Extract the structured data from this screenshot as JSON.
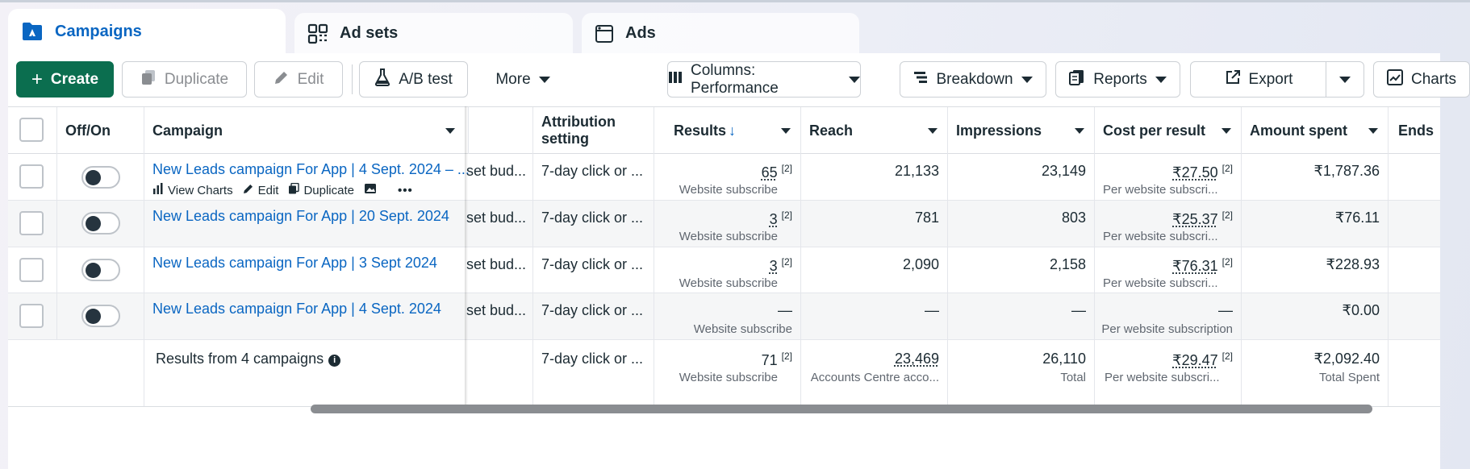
{
  "tabs": [
    {
      "label": "Campaigns",
      "icon": "campaign-folder-icon",
      "active": true
    },
    {
      "label": "Ad sets",
      "icon": "ad-sets-grid-icon",
      "active": false
    },
    {
      "label": "Ads",
      "icon": "ads-window-icon",
      "active": false
    }
  ],
  "toolbar": {
    "create": "Create",
    "duplicate": "Duplicate",
    "edit": "Edit",
    "ab_test": "A/B test",
    "more": "More",
    "columns": "Columns: Performance",
    "breakdown": "Breakdown",
    "reports": "Reports",
    "export": "Export",
    "charts": "Charts"
  },
  "columns": {
    "off_on": "Off/On",
    "campaign": "Campaign",
    "attribution_line1": "Attribution",
    "attribution_line2": "setting",
    "results": "Results",
    "results_sort": "↓",
    "reach": "Reach",
    "impressions": "Impressions",
    "cost_per_result": "Cost per result",
    "amount_spent": "Amount spent",
    "ends": "Ends"
  },
  "row_actions": {
    "view_charts": "View Charts",
    "edit": "Edit",
    "duplicate": "Duplicate",
    "more": "•••"
  },
  "rows": [
    {
      "name": "New Leads campaign For App | 4 Sept. 2024 – ...",
      "budget": "set bud...",
      "attribution": "7-day click or ...",
      "results": "65",
      "results_ref": "[2]",
      "results_sub": "Website subscribe",
      "reach": "21,133",
      "impressions": "23,149",
      "cpr": "₹27.50",
      "cpr_ref": "[2]",
      "cpr_sub": "Per website subscri...",
      "spent": "₹1,787.36"
    },
    {
      "name": "New Leads campaign For App | 20 Sept. 2024",
      "budget": "set bud...",
      "attribution": "7-day click or ...",
      "results": "3",
      "results_ref": "[2]",
      "results_sub": "Website subscribe",
      "reach": "781",
      "impressions": "803",
      "cpr": "₹25.37",
      "cpr_ref": "[2]",
      "cpr_sub": "Per website subscri...",
      "spent": "₹76.11"
    },
    {
      "name": "New Leads campaign For App | 3 Sept 2024",
      "budget": "set bud...",
      "attribution": "7-day click or ...",
      "results": "3",
      "results_ref": "[2]",
      "results_sub": "Website subscribe",
      "reach": "2,090",
      "impressions": "2,158",
      "cpr": "₹76.31",
      "cpr_ref": "[2]",
      "cpr_sub": "Per website subscri...",
      "spent": "₹228.93"
    },
    {
      "name": "New Leads campaign For App | 4 Sept. 2024",
      "budget": "set bud...",
      "attribution": "7-day click or ...",
      "results": "—",
      "results_ref": "",
      "results_sub": "Website subscribe",
      "reach": "—",
      "impressions": "—",
      "cpr": "—",
      "cpr_ref": "",
      "cpr_sub": "Per website subscription",
      "spent": "₹0.00"
    }
  ],
  "summary": {
    "label": "Results from 4 campaigns",
    "info_icon": "i",
    "attribution": "7-day click or ...",
    "results": "71",
    "results_ref": "[2]",
    "results_sub": "Website subscribe",
    "reach": "23,469",
    "reach_sub": "Accounts Centre acco...",
    "impressions": "26,110",
    "impressions_sub": "Total",
    "cpr": "₹29.47",
    "cpr_ref": "[2]",
    "cpr_sub": "Per website subscri...",
    "spent": "₹2,092.40",
    "spent_sub": "Total Spent"
  },
  "colors": {
    "accent_blue": "#0a66c2",
    "create_green": "#0b6e4f",
    "toggle_knob": "#26343f"
  }
}
